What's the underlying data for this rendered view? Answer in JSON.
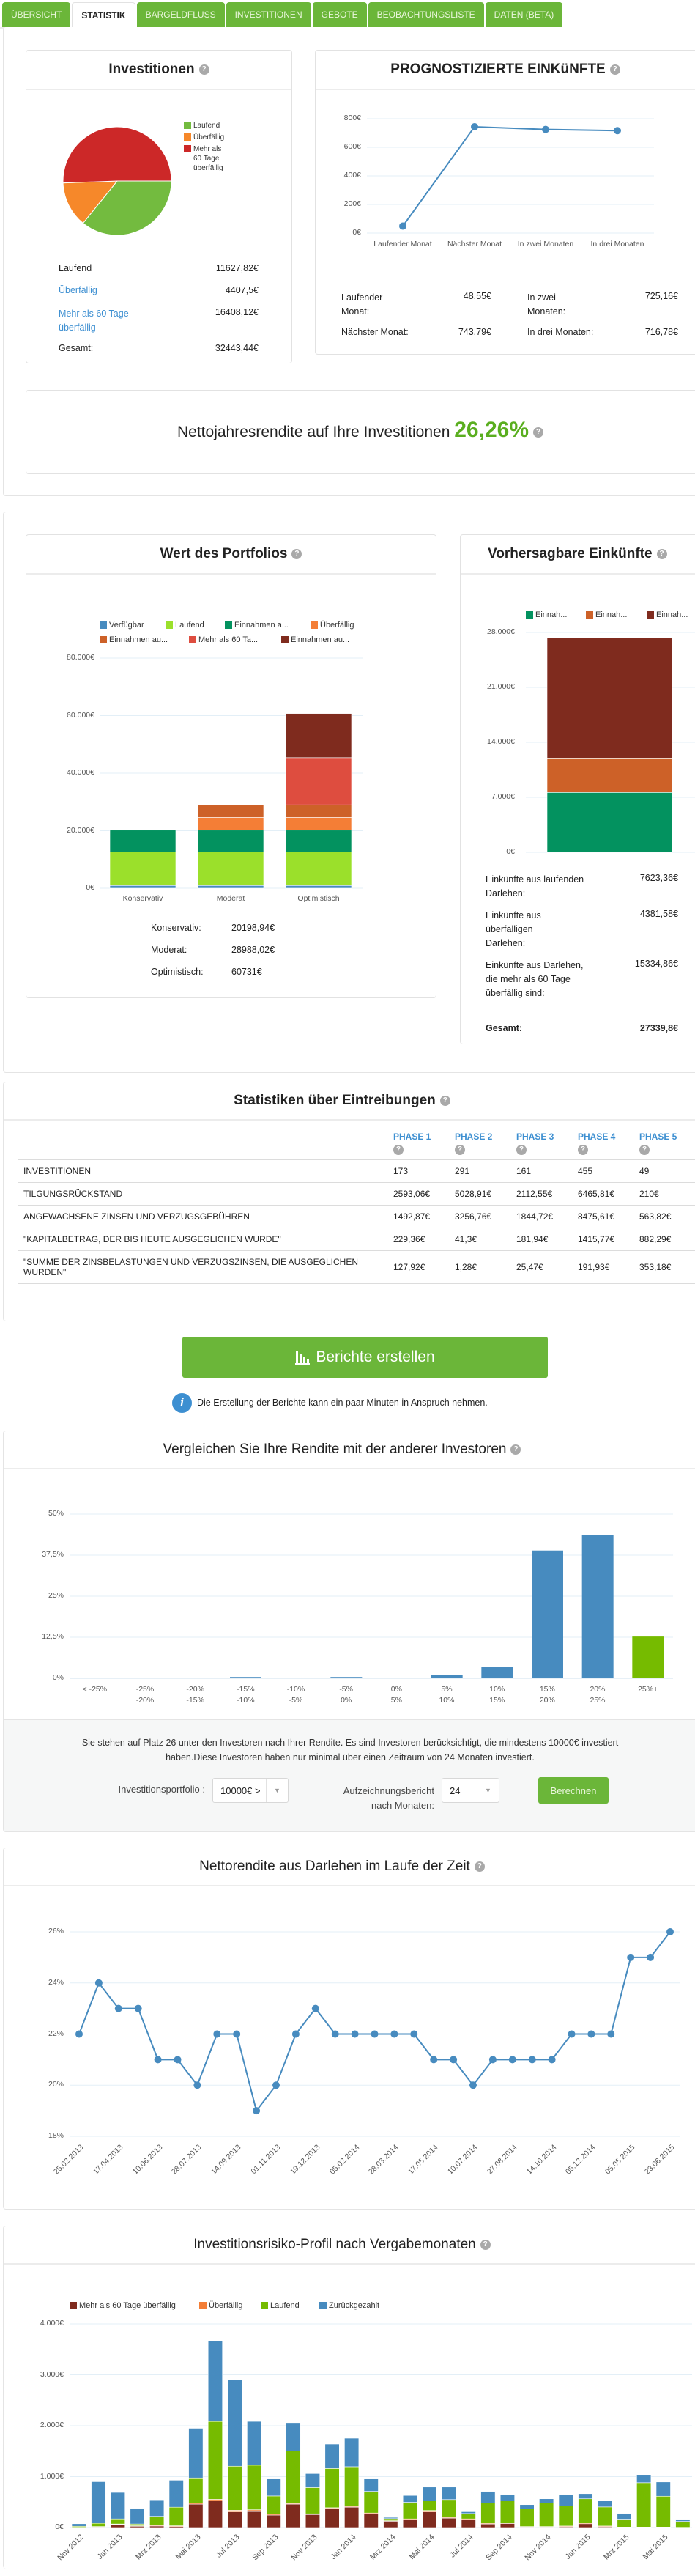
{
  "tabs": [
    "ÜBERSICHT",
    "STATISTIK",
    "BARGELDFLUSS",
    "INVESTITIONEN",
    "GEBOTE",
    "BEOBACHTUNGSLISTE",
    "DATEN (BETA)"
  ],
  "active_tab": "STATISTIK",
  "investments": {
    "title": "Investitionen",
    "rows": [
      {
        "label": "Laufend",
        "value": "11627,82€"
      },
      {
        "label": "Überfällig",
        "value": "4407,5€"
      },
      {
        "label": "Mehr als 60 Tage überfällig",
        "value": "16408,12€"
      },
      {
        "label": "Gesamt:",
        "value": "32443,44€"
      }
    ]
  },
  "projected": {
    "title": "PROGNOSTIZIERTE EINKüNFTE",
    "rows": [
      {
        "label": "Laufender Monat:",
        "value": "48,55€"
      },
      {
        "label": "In zwei Monaten:",
        "value": "725,16€"
      },
      {
        "label": "Nächster Monat:",
        "value": "743,79€"
      },
      {
        "label": "In drei Monaten:",
        "value": "716,78€"
      }
    ]
  },
  "net_return": {
    "label": "Nettojahresrendite auf Ihre Investitionen",
    "value": "26,26%"
  },
  "portfolio": {
    "title": "Wert des Portfolios",
    "summary": [
      {
        "label": "Konservativ:",
        "value": "20198,94€"
      },
      {
        "label": "Moderat:",
        "value": "28988,02€"
      },
      {
        "label": "Optimistisch:",
        "value": "60731€"
      }
    ]
  },
  "forecast": {
    "title": "Vorhersagbare Einkünfte",
    "rows": [
      {
        "label": "Einkünfte aus laufenden Darlehen:",
        "value": "7623,36€"
      },
      {
        "label": "Einkünfte aus überfälligen Darlehen:",
        "value": "4381,58€"
      },
      {
        "label": "Einkünfte aus Darlehen, die mehr als 60 Tage überfällig sind:",
        "value": "15334,86€"
      }
    ],
    "total_label": "Gesamt:",
    "total_value": "27339,8€"
  },
  "recovery": {
    "title": "Statistiken über Eintreibungen",
    "phases": [
      "PHASE 1",
      "PHASE 2",
      "PHASE 3",
      "PHASE 4",
      "PHASE 5"
    ],
    "rows": [
      {
        "label": "Investitionen",
        "values": [
          "173",
          "291",
          "161",
          "455",
          "49"
        ]
      },
      {
        "label": "Tilgungsrückstand",
        "values": [
          "2593,06€",
          "5028,91€",
          "2112,55€",
          "6465,81€",
          "210€"
        ]
      },
      {
        "label": "Angewachsene Zinsen und Verzugsgebühren",
        "values": [
          "1492,87€",
          "3256,76€",
          "1844,72€",
          "8475,61€",
          "563,82€"
        ]
      },
      {
        "label": "\"Kapitalbetrag, der bis heute ausgeglichen wurde\"",
        "values": [
          "229,36€",
          "41,3€",
          "181,94€",
          "1415,77€",
          "882,29€"
        ]
      },
      {
        "label": "\"Summe der Zinsbelastungen und Verzugszinsen, die ausgeglichen wurden\"",
        "values": [
          "127,92€",
          "1,28€",
          "25,47€",
          "191,93€",
          "353,18€"
        ]
      }
    ]
  },
  "report": {
    "button_label": "Berichte erstellen",
    "info": "Die Erstellung der Berichte kann ein paar Minuten in Anspruch nehmen."
  },
  "compare": {
    "title": "Vergleichen Sie Ihre Rendite mit der anderer Investoren",
    "text_1": "Sie stehen auf Platz 26 unter den Investoren nach Ihrer Rendite. Es sind Investoren berücksichtigt, die mindestens 10000€ investiert",
    "text_2": "haben.Diese Investoren haben nur minimal über einen Zeitraum von 24 Monaten investiert.",
    "portfolio_label": "Investitionsportfolio :",
    "portfolio_value": "10000€ >",
    "months_label_1": "Aufzeichnungsbericht",
    "months_label_2": "nach Monaten:",
    "months_value": "24",
    "calc_button": "Berechnen"
  },
  "return_over_time": {
    "title": "Nettorendite aus Darlehen im Laufe der Zeit"
  },
  "risk_profile": {
    "title": "Investitionsrisiko-Profil nach Vergabemonaten"
  },
  "colors": {
    "brand": "#6bb639",
    "link": "#3d8fd1",
    "accent_blue": "#478bbf"
  },
  "chart_data": [
    {
      "type": "pie",
      "labels": [
        "Laufend",
        "Überfällig",
        "Mehr als 60 Tage überfällig"
      ],
      "legend": [
        "Laufend",
        "Überfällig",
        "Mehr als 60 Tage überfällig"
      ],
      "values": [
        11627.82,
        4407.5,
        16408.12
      ],
      "colors": [
        "#73bb3f",
        "#f6882a",
        "#cc2828"
      ],
      "legend_position": "right"
    },
    {
      "type": "line",
      "categories": [
        "Laufender Monat",
        "Nächster Monat",
        "In zwei Monaten",
        "In drei Monaten"
      ],
      "values": [
        48.55,
        743.79,
        725.16,
        716.78
      ],
      "yticks": [
        0,
        200,
        400,
        600,
        800
      ],
      "ytick_labels": [
        "0€",
        "200€",
        "400€",
        "600€",
        "800€"
      ],
      "ylim": [
        0,
        800
      ],
      "color": "#478bbf"
    },
    {
      "type": "bar",
      "stacked": true,
      "categories": [
        "Konservativ",
        "Moderat",
        "Optimistisch"
      ],
      "yticks": [
        0,
        20000,
        40000,
        60000,
        80000
      ],
      "ytick_labels": [
        "0€",
        "20.000€",
        "40.000€",
        "60.000€",
        "80.000€"
      ],
      "ylim": [
        0,
        80000
      ],
      "series": [
        {
          "name": "Verfügbar",
          "color": "#478bbf",
          "values": [
            947.76,
            947.76,
            947.76
          ]
        },
        {
          "name": "Laufend",
          "color": "#9be02b",
          "values": [
            11627.82,
            11627.82,
            11627.82
          ]
        },
        {
          "name": "Einnahmen a...",
          "color": "#03925f",
          "values": [
            7623.36,
            7623.36,
            7623.36
          ]
        },
        {
          "name": "Überfällig",
          "color": "#f47e36",
          "values": [
            0,
            4407.5,
            4407.5
          ]
        },
        {
          "name": "Einnahmen au...",
          "color": "#cd6128",
          "values": [
            0,
            4381.58,
            4381.58
          ]
        },
        {
          "name": "Mehr als 60 Ta...",
          "color": "#de4d3f",
          "values": [
            0,
            0,
            16408.12
          ]
        },
        {
          "name": "Einnahmen au...",
          "color": "#7f2b1e",
          "values": [
            0,
            0,
            15334.86
          ]
        }
      ],
      "legend_position": "top"
    },
    {
      "type": "bar",
      "stacked": true,
      "categories": [
        ""
      ],
      "yticks": [
        0,
        7000,
        14000,
        21000,
        28000
      ],
      "ytick_labels": [
        "0€",
        "7.000€",
        "14.000€",
        "21.000€",
        "28.000€"
      ],
      "ylim": [
        0,
        28000
      ],
      "series": [
        {
          "name": "Einnah...",
          "color": "#03925f",
          "values": [
            7623.36
          ]
        },
        {
          "name": "Einnah...",
          "color": "#cd6128",
          "values": [
            4381.58
          ]
        },
        {
          "name": "Einnah...",
          "color": "#7f2b1e",
          "values": [
            15334.86
          ]
        }
      ],
      "legend_position": "top"
    },
    {
      "type": "bar",
      "categories": [
        [
          "< -25%",
          ""
        ],
        [
          "-25%",
          "-20%"
        ],
        [
          "-20%",
          "-15%"
        ],
        [
          "-15%",
          "-10%"
        ],
        [
          "-10%",
          "-5%"
        ],
        [
          "-5%",
          "0%"
        ],
        [
          "0%",
          "5%"
        ],
        [
          "5%",
          "10%"
        ],
        [
          "10%",
          "15%"
        ],
        [
          "15%",
          "20%"
        ],
        [
          "20%",
          "25%"
        ],
        [
          "25%+",
          ""
        ]
      ],
      "values": [
        0.2,
        0.2,
        0.2,
        0.4,
        0.2,
        0.4,
        0.2,
        0.9,
        3.4,
        38.9,
        43.6,
        12.7
      ],
      "highlight_index": 11,
      "colors": {
        "bar": "#478bbf",
        "highlight": "#76bb00"
      },
      "yticks": [
        0,
        12.5,
        25,
        37.5,
        50
      ],
      "ytick_labels": [
        "0%",
        "12,5%",
        "25%",
        "37,5%",
        "50%"
      ],
      "ylim": [
        0,
        50
      ]
    },
    {
      "type": "line",
      "categories": [
        "25.02.2013",
        "",
        "17.04.2013",
        "",
        "10.06.2013",
        "",
        "28.07.2013",
        "",
        "14.09.2013",
        "",
        "01.11.2013",
        "",
        "19.12.2013",
        "",
        "05.02.2014",
        "",
        "28.03.2014",
        "",
        "17.05.2014",
        "",
        "10.07.2014",
        "",
        "27.08.2014",
        "",
        "14.10.2014",
        "",
        "05.12.2014",
        "",
        "05.05.2015",
        "",
        "23.06.2015"
      ],
      "values": [
        22,
        24,
        23,
        23,
        21,
        21,
        20,
        22,
        22,
        19,
        20,
        22,
        23,
        22,
        22,
        22,
        22,
        22,
        21,
        21,
        20,
        21,
        21,
        21,
        21,
        22,
        22,
        22,
        25,
        25,
        26
      ],
      "yticks": [
        18,
        20,
        22,
        24,
        26
      ],
      "ytick_labels": [
        "18%",
        "20%",
        "22%",
        "24%",
        "26%"
      ],
      "ylim": [
        18,
        26
      ],
      "color": "#478bbf"
    },
    {
      "type": "bar",
      "stacked": true,
      "categories": [
        "Nov 2012",
        "",
        "Jan 2013",
        "",
        "Mrz 2013",
        "",
        "Mai 2013",
        "",
        "Jul 2013",
        "",
        "Sep 2013",
        "",
        "Nov 2013",
        "",
        "Jan 2014",
        "",
        "Mrz 2014",
        "",
        "Mai 2014",
        "",
        "Jul 2014",
        "",
        "Sep 2014",
        "",
        "Nov 2014",
        "",
        "Jan 2015",
        "",
        "Mrz 2015",
        "",
        "Mai 2015",
        ""
      ],
      "yticks": [
        0,
        1000,
        2000,
        3000,
        4000
      ],
      "ytick_labels": [
        "0€",
        "1.000€",
        "2.000€",
        "3.000€",
        "4.000€"
      ],
      "ylim": [
        0,
        4000
      ],
      "series": [
        {
          "name": "Mehr als 60 Tage überfällig",
          "color": "#7f2b1e",
          "values": [
            5,
            10,
            60,
            25,
            30,
            20,
            460,
            530,
            320,
            330,
            245,
            460,
            255,
            375,
            400,
            270,
            125,
            155,
            320,
            185,
            155,
            70,
            80,
            10,
            10,
            15,
            75,
            15,
            5,
            5,
            5,
            0
          ]
        },
        {
          "name": "Überfällig",
          "color": "#f47e36",
          "values": [
            0,
            10,
            10,
            10,
            15,
            15,
            20,
            25,
            20,
            20,
            20,
            15,
            15,
            15,
            15,
            15,
            10,
            15,
            15,
            15,
            15,
            15,
            15,
            10,
            10,
            15,
            15,
            15,
            5,
            5,
            5,
            5
          ]
        },
        {
          "name": "Laufend",
          "color": "#76bb00",
          "values": [
            20,
            65,
            100,
            35,
            175,
            365,
            495,
            1530,
            865,
            875,
            355,
            1030,
            515,
            770,
            780,
            425,
            40,
            325,
            190,
            350,
            105,
            395,
            430,
            345,
            460,
            395,
            475,
            375,
            155,
            870,
            605,
            115
          ]
        },
        {
          "name": "Zurückgezahlt",
          "color": "#478bbf",
          "values": [
            50,
            815,
            520,
            305,
            325,
            530,
            975,
            1575,
            1705,
            860,
            345,
            555,
            275,
            480,
            560,
            255,
            25,
            135,
            270,
            245,
            50,
            230,
            125,
            85,
            85,
            225,
            100,
            130,
            110,
            160,
            280,
            40
          ]
        }
      ],
      "legend_position": "top-left"
    }
  ]
}
